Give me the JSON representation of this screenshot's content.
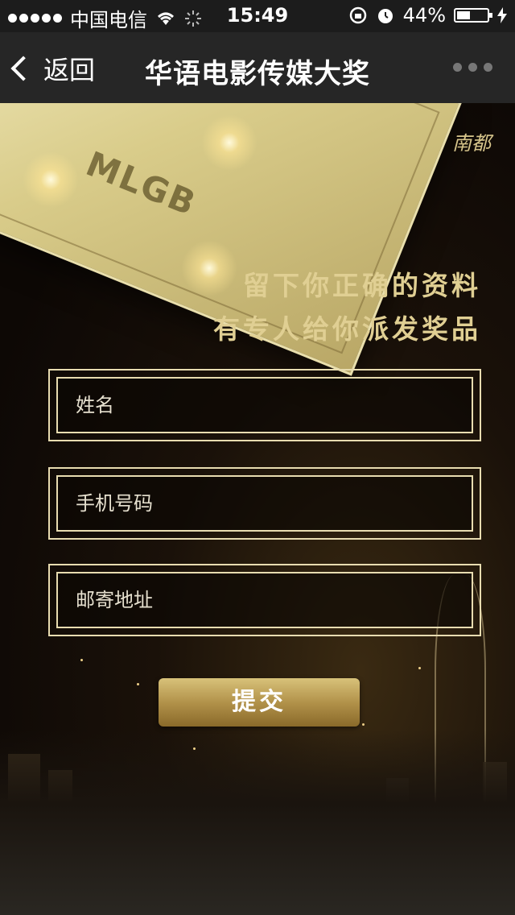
{
  "status_bar": {
    "carrier": "中国电信",
    "time": "15:49",
    "battery": "44%",
    "battery_level": 0.44
  },
  "nav": {
    "back_label": "返回",
    "title": "华语电影传媒大奖"
  },
  "banner": {
    "brand": "南都",
    "ticket_text": "MLGB"
  },
  "slogan": {
    "line1": "留下你正确的资料",
    "line2": "有专人给你派发奖品"
  },
  "form": {
    "name_placeholder": "姓名",
    "phone_placeholder": "手机号码",
    "address_placeholder": "邮寄地址",
    "submit_label": "提交"
  },
  "icons": {
    "wifi": "wifi-icon",
    "loading": "loading-icon",
    "lock_rotation": "lock-rotation-icon",
    "alarm": "alarm-icon",
    "battery": "battery-icon",
    "charging": "charging-icon",
    "back": "chevron-left-icon",
    "more": "more-dots-icon"
  }
}
